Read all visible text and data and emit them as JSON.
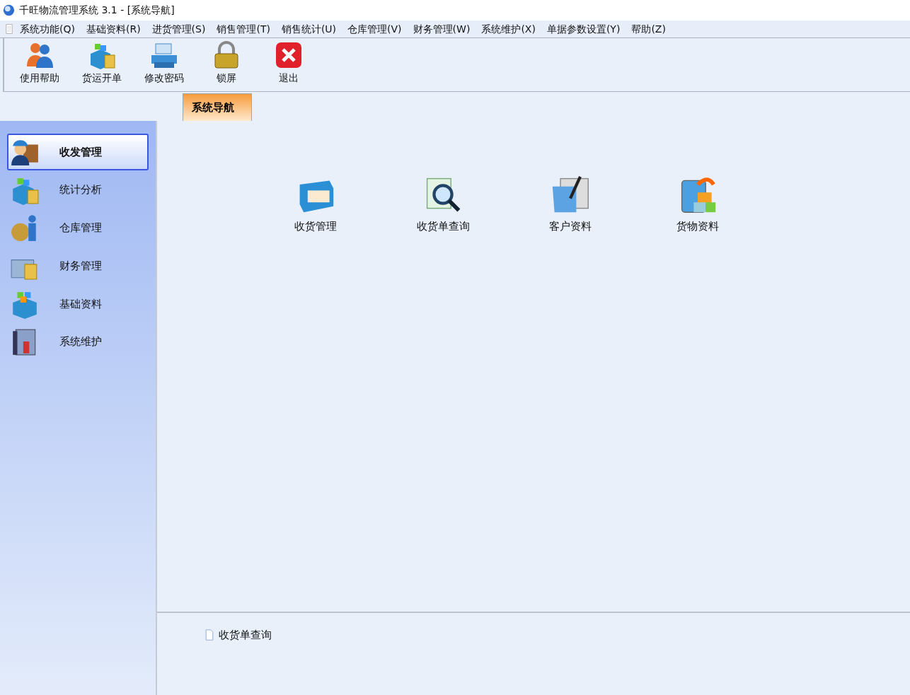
{
  "window": {
    "title": "千旺物流管理系统 3.1 - [系统导航]"
  },
  "menu_bar": [
    "系统功能(Q)",
    "基础资料(R)",
    "进货管理(S)",
    "销售管理(T)",
    "销售统计(U)",
    "仓库管理(V)",
    "财务管理(W)",
    "系统维护(X)",
    "单据参数设置(Y)",
    "帮助(Z)"
  ],
  "toolbar": [
    "使用帮助",
    "货运开单",
    "修改密码",
    "锁屏",
    "退出"
  ],
  "tabs": [
    {
      "label": "系统导航",
      "selected": true
    }
  ],
  "sidebar": {
    "items": [
      {
        "label": "收发管理",
        "selected": true
      },
      {
        "label": "统计分析",
        "selected": false
      },
      {
        "label": "仓库管理",
        "selected": false
      },
      {
        "label": "财务管理",
        "selected": false
      },
      {
        "label": "基础资料",
        "selected": false
      },
      {
        "label": "系统维护",
        "selected": false
      }
    ]
  },
  "modules": [
    "收货管理",
    "收货单查询",
    "客户资料",
    "货物资料"
  ],
  "recent": [
    "收货单查询"
  ]
}
